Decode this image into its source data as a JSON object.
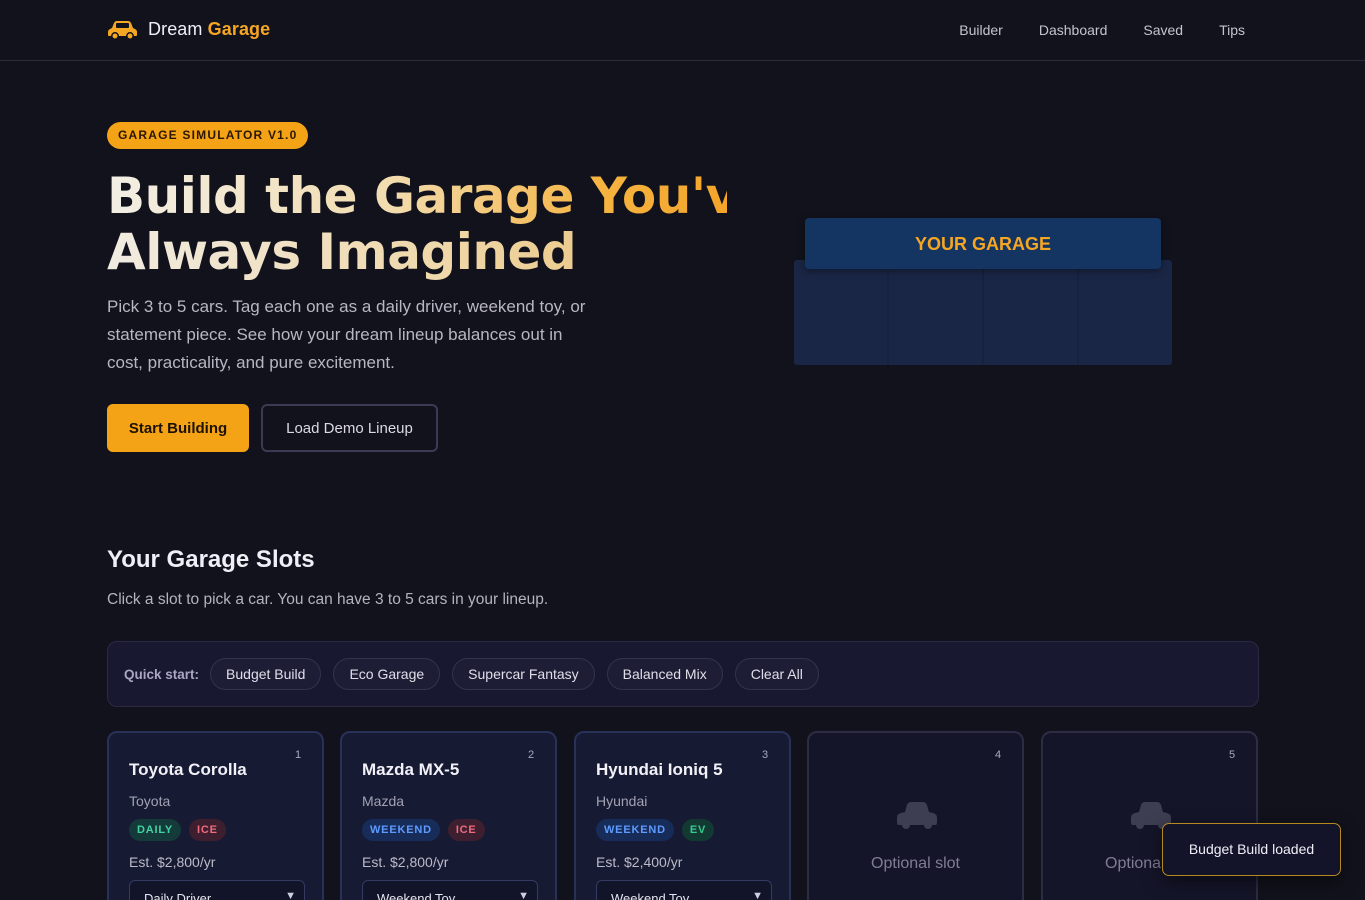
{
  "brand": {
    "name_prefix": "Dream",
    "name_accent": "Garage",
    "icon": "car-icon",
    "accent_color": "#f5a623"
  },
  "nav": {
    "links": [
      "Builder",
      "Dashboard",
      "Saved",
      "Tips"
    ]
  },
  "hero": {
    "badge": "GARAGE SIMULATOR V1.0",
    "title_line1": "Build the Garage You've",
    "title_line2": "Always Imagined",
    "description": "Pick 3 to 5 cars. Tag each one as a daily driver, weekend toy, or statement piece. See how your dream lineup balances out in cost, practicality, and pure excitement.",
    "primary_button": "Start Building",
    "secondary_button": "Load Demo Lineup"
  },
  "garage_illustration": {
    "sign": "YOUR GARAGE"
  },
  "slots_section": {
    "title": "Your Garage Slots",
    "subtitle": "Click a slot to pick a car. You can have 3 to 5 cars in your lineup.",
    "quick_start_label": "Quick start:",
    "quick_start_options": [
      "Budget Build",
      "Eco Garage",
      "Supercar Fantasy",
      "Balanced Mix",
      "Clear All"
    ],
    "slots": [
      {
        "number": "1",
        "name": "Toyota Corolla",
        "make": "Toyota",
        "tags": [
          "DAILY",
          "ICE"
        ],
        "cost": "Est. $2,800/yr",
        "role": "Daily Driver"
      },
      {
        "number": "2",
        "name": "Mazda MX-5",
        "make": "Mazda",
        "tags": [
          "WEEKEND",
          "ICE"
        ],
        "cost": "Est. $2,800/yr",
        "role": "Weekend Toy"
      },
      {
        "number": "3",
        "name": "Hyundai Ioniq 5",
        "make": "Hyundai",
        "tags": [
          "WEEKEND",
          "EV"
        ],
        "cost": "Est. $2,400/yr",
        "role": "Weekend Toy"
      },
      {
        "number": "4",
        "empty_label": "Optional slot"
      },
      {
        "number": "5",
        "empty_label": "Optional slot"
      }
    ]
  },
  "toast": {
    "message": "Budget Build loaded"
  }
}
